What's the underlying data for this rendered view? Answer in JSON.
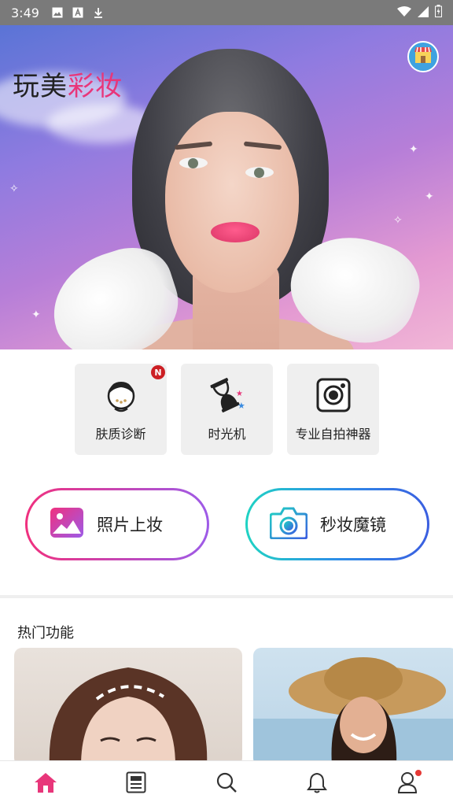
{
  "status_bar": {
    "time": "3:49",
    "left_icons": [
      "image-icon",
      "font-icon",
      "download-icon"
    ],
    "right_icons": [
      "wifi-icon",
      "signal-icon",
      "battery-icon"
    ]
  },
  "header": {
    "title_part1": "玩美",
    "title_part2": "彩妆",
    "accent_color": "#e8367a",
    "store_icon": "store-icon"
  },
  "features": [
    {
      "label": "肤质诊断",
      "icon": "skin-diagnosis-icon",
      "badge": "N"
    },
    {
      "label": "时光机",
      "icon": "hourglass-icon"
    },
    {
      "label": "专业自拍神器",
      "icon": "camera-lens-icon"
    }
  ],
  "actions": {
    "photo_makeup": "照片上妆",
    "magic_mirror": "秒妆魔镜"
  },
  "section": {
    "title": "热门功能"
  },
  "nav": [
    {
      "name": "home",
      "icon": "home-icon",
      "active": true,
      "color": "#e8367a"
    },
    {
      "name": "feed",
      "icon": "newspaper-icon"
    },
    {
      "name": "search",
      "icon": "search-icon"
    },
    {
      "name": "notifications",
      "icon": "bell-icon"
    },
    {
      "name": "profile",
      "icon": "user-icon",
      "dot": true
    }
  ]
}
